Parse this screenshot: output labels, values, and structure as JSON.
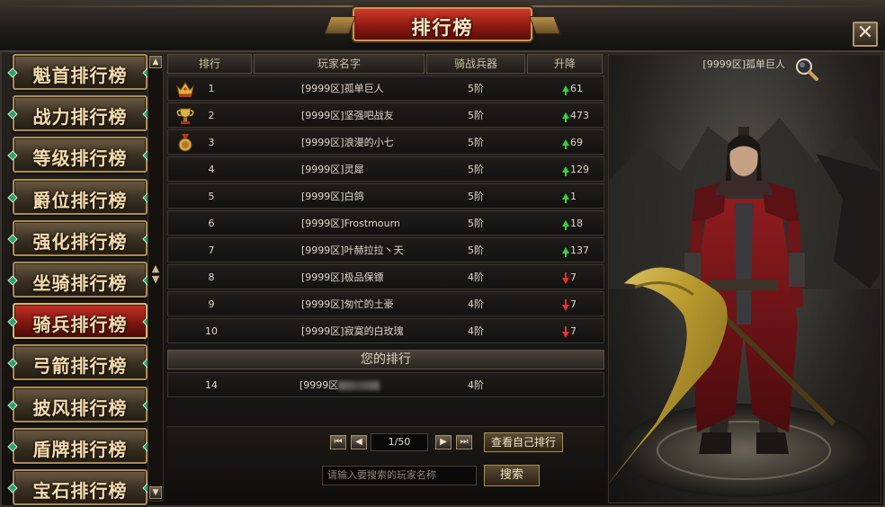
{
  "window": {
    "title": "排行榜",
    "close_label": "✕"
  },
  "tabs": [
    {
      "label": "魁首排行榜",
      "active": false
    },
    {
      "label": "战力排行榜",
      "active": false
    },
    {
      "label": "等级排行榜",
      "active": false
    },
    {
      "label": "爵位排行榜",
      "active": false
    },
    {
      "label": "强化排行榜",
      "active": false
    },
    {
      "label": "坐骑排行榜",
      "active": false
    },
    {
      "label": "骑兵排行榜",
      "active": true
    },
    {
      "label": "弓箭排行榜",
      "active": false
    },
    {
      "label": "披风排行榜",
      "active": false
    },
    {
      "label": "盾牌排行榜",
      "active": false
    },
    {
      "label": "宝石排行榜",
      "active": false
    }
  ],
  "table": {
    "headers": [
      "排行",
      "玩家名字",
      "骑战兵器",
      "升降"
    ],
    "rows": [
      {
        "rank": "1",
        "name": "[9999区]孤单巨人",
        "level": "5阶",
        "change": "61",
        "dir": "up",
        "medal": "crown"
      },
      {
        "rank": "2",
        "name": "[9999区]坚强吧战友",
        "level": "5阶",
        "change": "473",
        "dir": "up",
        "medal": "trophy"
      },
      {
        "rank": "3",
        "name": "[9999区]浪漫的小七",
        "level": "5阶",
        "change": "69",
        "dir": "up",
        "medal": "medal"
      },
      {
        "rank": "4",
        "name": "[9999区]灵犀",
        "level": "5阶",
        "change": "129",
        "dir": "up",
        "medal": ""
      },
      {
        "rank": "5",
        "name": "[9999区]白鸽",
        "level": "5阶",
        "change": "1",
        "dir": "up",
        "medal": ""
      },
      {
        "rank": "6",
        "name": "[9999区]Frostmourn",
        "level": "5阶",
        "change": "18",
        "dir": "up",
        "medal": ""
      },
      {
        "rank": "7",
        "name": "[9999区]叶赫拉拉丶天",
        "level": "5阶",
        "change": "137",
        "dir": "up",
        "medal": ""
      },
      {
        "rank": "8",
        "name": "[9999区]极品保镖",
        "level": "4阶",
        "change": "7",
        "dir": "down",
        "medal": ""
      },
      {
        "rank": "9",
        "name": "[9999区]匆忙的土豪",
        "level": "4阶",
        "change": "7",
        "dir": "down",
        "medal": ""
      },
      {
        "rank": "10",
        "name": "[9999区]寂寞的白玫瑰",
        "level": "4阶",
        "change": "7",
        "dir": "down",
        "medal": ""
      }
    ]
  },
  "your_rank": {
    "label": "您的排行",
    "rank": "14",
    "name_prefix": "[9999区",
    "level": "4阶"
  },
  "pager": {
    "first": "⏮",
    "prev": "◀",
    "page": "1/50",
    "next": "▶",
    "last": "⏭",
    "view_self": "查看自己排行"
  },
  "search": {
    "placeholder": "请输入要搜索的玩家名称",
    "button": "搜索"
  },
  "character": {
    "name": "[9999区]孤单巨人"
  },
  "colors": {
    "up": "#2fd33a",
    "down": "#e6322a",
    "gold": "#c9a35c",
    "active_tab": "#9e1f16"
  }
}
